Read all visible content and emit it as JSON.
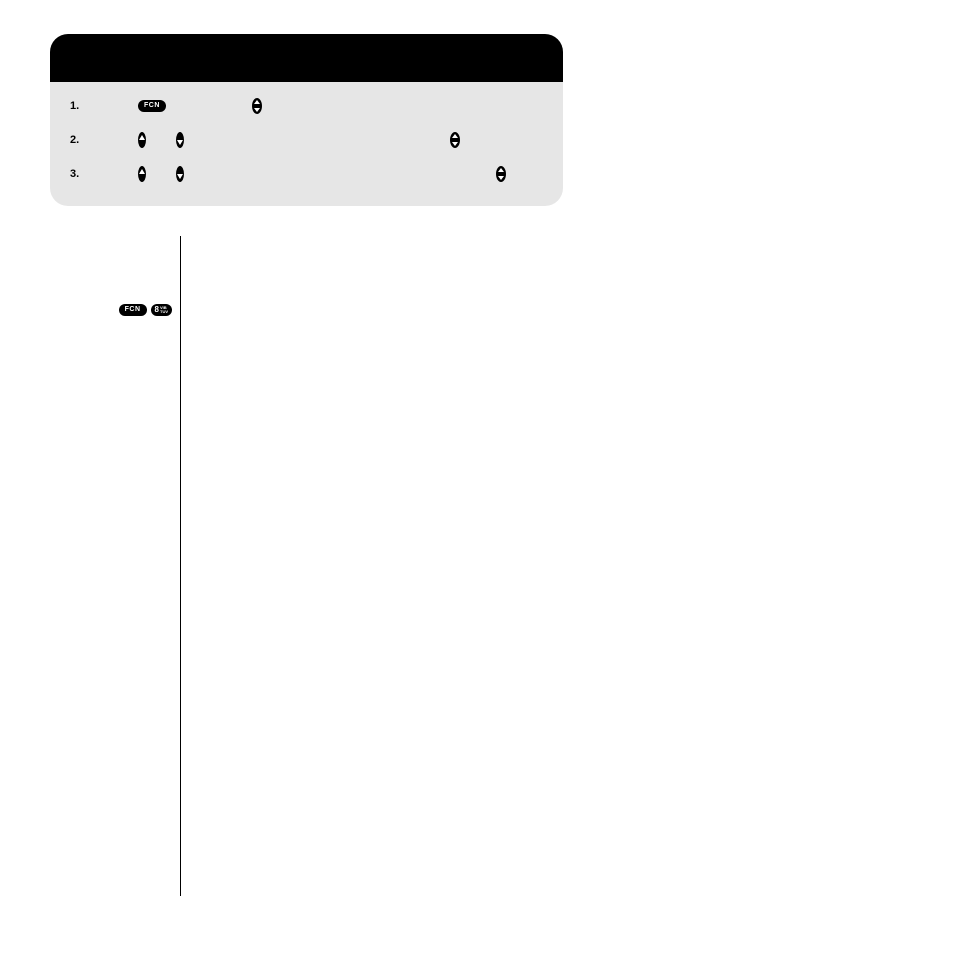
{
  "card": {
    "steps": [
      {
        "num": "1.",
        "tokens": [
          "FCN",
          "updown"
        ]
      },
      {
        "num": "2.",
        "tokens": [
          "up",
          "down",
          "spacer",
          "updown"
        ]
      },
      {
        "num": "3.",
        "tokens": [
          "up",
          "down",
          "spacer2",
          "updown"
        ]
      }
    ]
  },
  "shortcut": {
    "fcn": "FCN",
    "key_num": "8",
    "key_sub1": "VIB",
    "key_sub2": "TUV"
  }
}
